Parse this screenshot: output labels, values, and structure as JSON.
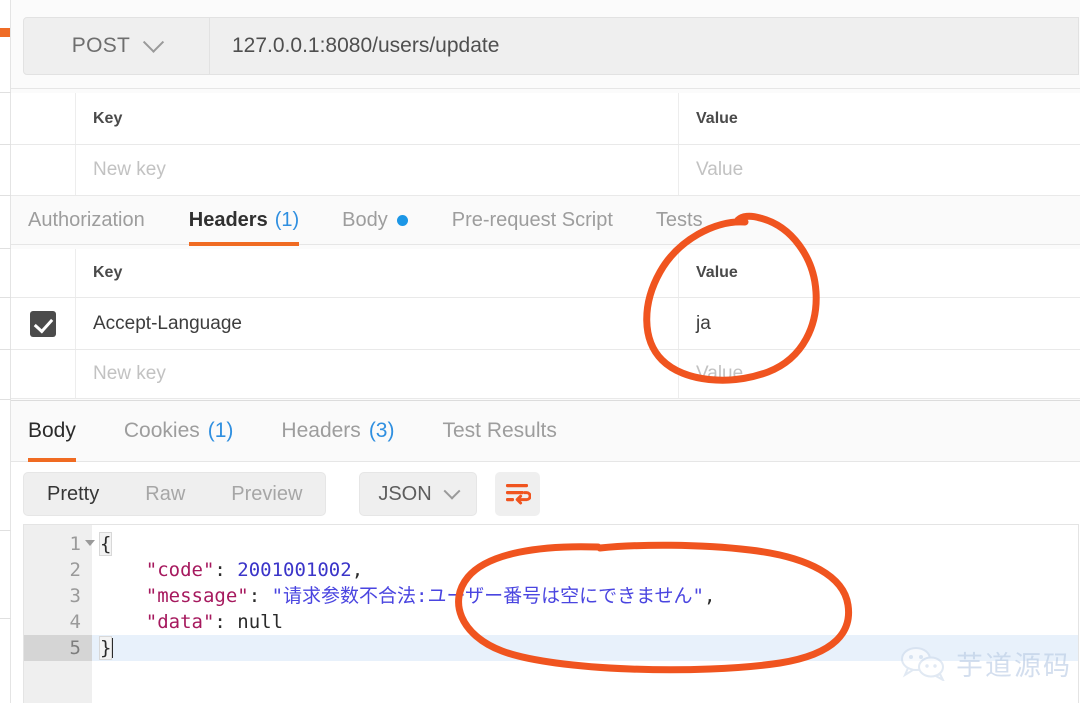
{
  "request": {
    "method": "POST",
    "method_icon": "chevron-down-icon",
    "url": "127.0.0.1:8080/users/update",
    "params_table": {
      "col_key": "Key",
      "col_value": "Value",
      "new_row": {
        "key_placeholder": "New key",
        "value_placeholder": "Value"
      }
    },
    "tabs": [
      {
        "label": "Authorization",
        "active": false,
        "count": "",
        "dot": false
      },
      {
        "label": "Headers",
        "active": true,
        "count": "(1)",
        "dot": false
      },
      {
        "label": "Body",
        "active": false,
        "count": "",
        "dot": true
      },
      {
        "label": "Pre-request Script",
        "active": false,
        "count": "",
        "dot": false
      },
      {
        "label": "Tests",
        "active": false,
        "count": "",
        "dot": false
      }
    ],
    "headers_table": {
      "col_key": "Key",
      "col_value": "Value",
      "rows": [
        {
          "enabled": true,
          "key": "Accept-Language",
          "value": "ja"
        }
      ],
      "new_row": {
        "key_placeholder": "New key",
        "value_placeholder": "Value"
      }
    }
  },
  "response": {
    "tabs": [
      {
        "label": "Body",
        "active": true,
        "count": ""
      },
      {
        "label": "Cookies",
        "active": false,
        "count": "(1)"
      },
      {
        "label": "Headers",
        "active": false,
        "count": "(3)"
      },
      {
        "label": "Test Results",
        "active": false,
        "count": ""
      }
    ],
    "format_modes": [
      {
        "label": "Pretty",
        "active": true
      },
      {
        "label": "Raw",
        "active": false
      },
      {
        "label": "Preview",
        "active": false
      }
    ],
    "language": "JSON",
    "language_icon": "chevron-down-icon",
    "wrap_button_icon": "word-wrap-icon",
    "body": {
      "lines": [
        "1",
        "2",
        "3",
        "4",
        "5"
      ],
      "active_line": "5",
      "code": {
        "open_brace": "{",
        "close_brace": "}",
        "entries": [
          {
            "key": "\"code\"",
            "sep": ": ",
            "value": "2001001002",
            "value_type": "num",
            "comma": ","
          },
          {
            "key": "\"message\"",
            "sep": ": ",
            "value": "\"请求参数不合法:ユーザー番号は空にできません\"",
            "value_type": "str",
            "comma": ","
          },
          {
            "key": "\"data\"",
            "sep": ": ",
            "value": "null",
            "value_type": "null",
            "comma": ""
          }
        ]
      }
    }
  },
  "annotations": {
    "color": "#f0541f",
    "circle_value_label": "circle around response header value ja",
    "ellipse_message_label": "ellipse around japanese error message"
  },
  "watermark": {
    "text": "芋道源码",
    "icon": "wechat-icon"
  },
  "colors": {
    "accent_orange": "#f06b22",
    "link_blue": "#2f8fe0",
    "body_dot_blue": "#1b96e6",
    "annotation_orange": "#f0541f",
    "json_key": "#a6195e",
    "json_value": "#4a45e0"
  }
}
